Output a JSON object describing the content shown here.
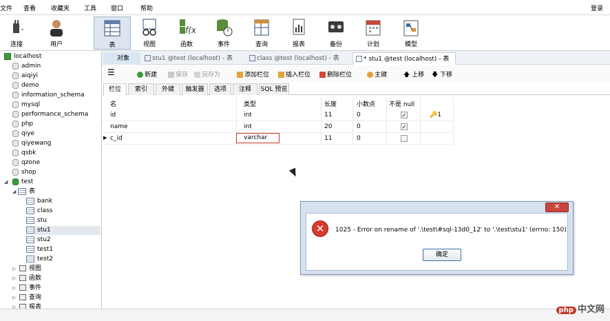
{
  "menubar": {
    "items": [
      "文件",
      "查看",
      "收藏夹",
      "工具",
      "窗口",
      "帮助"
    ],
    "login": "登录"
  },
  "toolbar": {
    "buttons": [
      {
        "label": "连接",
        "icon": "plug-icon"
      },
      {
        "label": "用户",
        "icon": "user-icon"
      },
      {
        "label": "表",
        "icon": "table-icon"
      },
      {
        "label": "视图",
        "icon": "view-icon"
      },
      {
        "label": "函数",
        "icon": "function-icon"
      },
      {
        "label": "事件",
        "icon": "event-icon"
      },
      {
        "label": "查询",
        "icon": "query-icon"
      },
      {
        "label": "报表",
        "icon": "report-icon"
      },
      {
        "label": "备份",
        "icon": "backup-icon"
      },
      {
        "label": "计划",
        "icon": "schedule-icon"
      },
      {
        "label": "模型",
        "icon": "model-icon"
      }
    ]
  },
  "tree": {
    "connection": "localhost",
    "databases": [
      "admin",
      "aiqiyi",
      "demo",
      "information_schema",
      "mysql",
      "performance_schema",
      "php",
      "qiye",
      "qiyewang",
      "qsbk",
      "qzone",
      "shop"
    ],
    "open_db": "test",
    "tables_label": "表",
    "tables": [
      "bank",
      "class",
      "stu",
      "stu1",
      "stu2",
      "test1",
      "test2"
    ],
    "others": [
      "视图",
      "函数",
      "事件",
      "查询",
      "报表"
    ]
  },
  "tabs": {
    "object": "对象",
    "t1": "stu1 @test (localhost) - 表",
    "t2": "class @test (localhost) - 表",
    "t3": "* stu1 @test (localhost) - 表"
  },
  "editor_toolbar": {
    "new": "新建",
    "save": "保存",
    "save_as": "另存为",
    "add_col": "添加栏位",
    "insert_col": "插入栏位",
    "delete_col": "删除栏位",
    "primary": "主键",
    "up": "上移",
    "down": "下移"
  },
  "subtabs": [
    "栏位",
    "索引",
    "外键",
    "触发器",
    "选项",
    "注释",
    "SQL 预览"
  ],
  "grid": {
    "headers": [
      "名",
      "类型",
      "长度",
      "小数点",
      "不是 null"
    ],
    "rows": [
      {
        "name": "id",
        "type": "int",
        "length": "11",
        "decimals": "0",
        "not_null": true,
        "key": "1"
      },
      {
        "name": "name",
        "type": "int",
        "length": "20",
        "decimals": "0",
        "not_null": true,
        "key": ""
      },
      {
        "name": "c_id",
        "type": "varchar",
        "length": "11",
        "decimals": "0",
        "not_null": false,
        "key": ""
      }
    ]
  },
  "dialog": {
    "message": "1025 - Error on rename of '.\\test\\#sql-13d0_12' to '.\\test\\stu1' (errno: 150)",
    "ok": "确定"
  },
  "watermark": {
    "badge": "php",
    "text": "中文网"
  }
}
